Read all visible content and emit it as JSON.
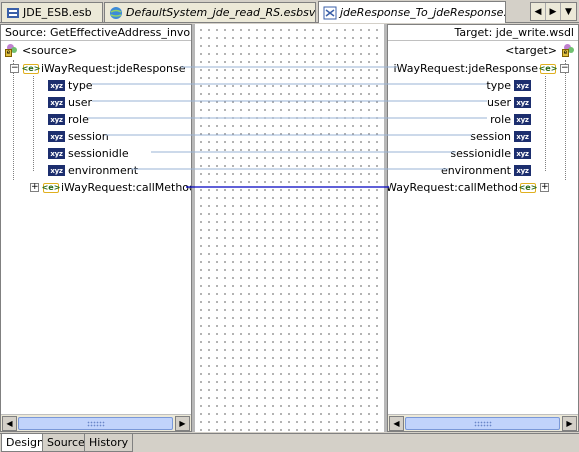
{
  "tabs": [
    {
      "label": "JDE_ESB.esb",
      "italic": false
    },
    {
      "label": "DefaultSystem_jde_read_RS.esbsvc",
      "italic": true
    },
    {
      "label": "jdeResponse_To_jdeResponse.xsl",
      "italic": true
    }
  ],
  "nav": {
    "back": "◀",
    "forward": "▶",
    "menu": "▼"
  },
  "source": {
    "header": "Source: GetEffectiveAddress_invoke.wsdl",
    "root": "<source>",
    "element": "iWayRequest:jdeResponse",
    "fields": [
      "type",
      "user",
      "role",
      "session",
      "sessionidle",
      "environment"
    ],
    "collapsed": "iWayRequest:callMethod"
  },
  "target": {
    "header": "Target: jde_write.wsdl",
    "root": "<target>",
    "element": "iWayRequest:jdeResponse",
    "fields": [
      "type",
      "user",
      "role",
      "session",
      "sessionidle",
      "environment"
    ],
    "collapsed": "iWayRequest:callMethod"
  },
  "icons": {
    "element": "<e>",
    "field": "xyz",
    "expand": "+",
    "collapse": "−"
  },
  "scroll": {
    "left": "◀",
    "right": "▶"
  },
  "bottom_tabs": [
    "Design",
    "Source",
    "History"
  ],
  "colors": {
    "map_line": "#9ab3d6",
    "selected_map_line": "#0000c0",
    "field_icon": "#1c2e6e"
  }
}
